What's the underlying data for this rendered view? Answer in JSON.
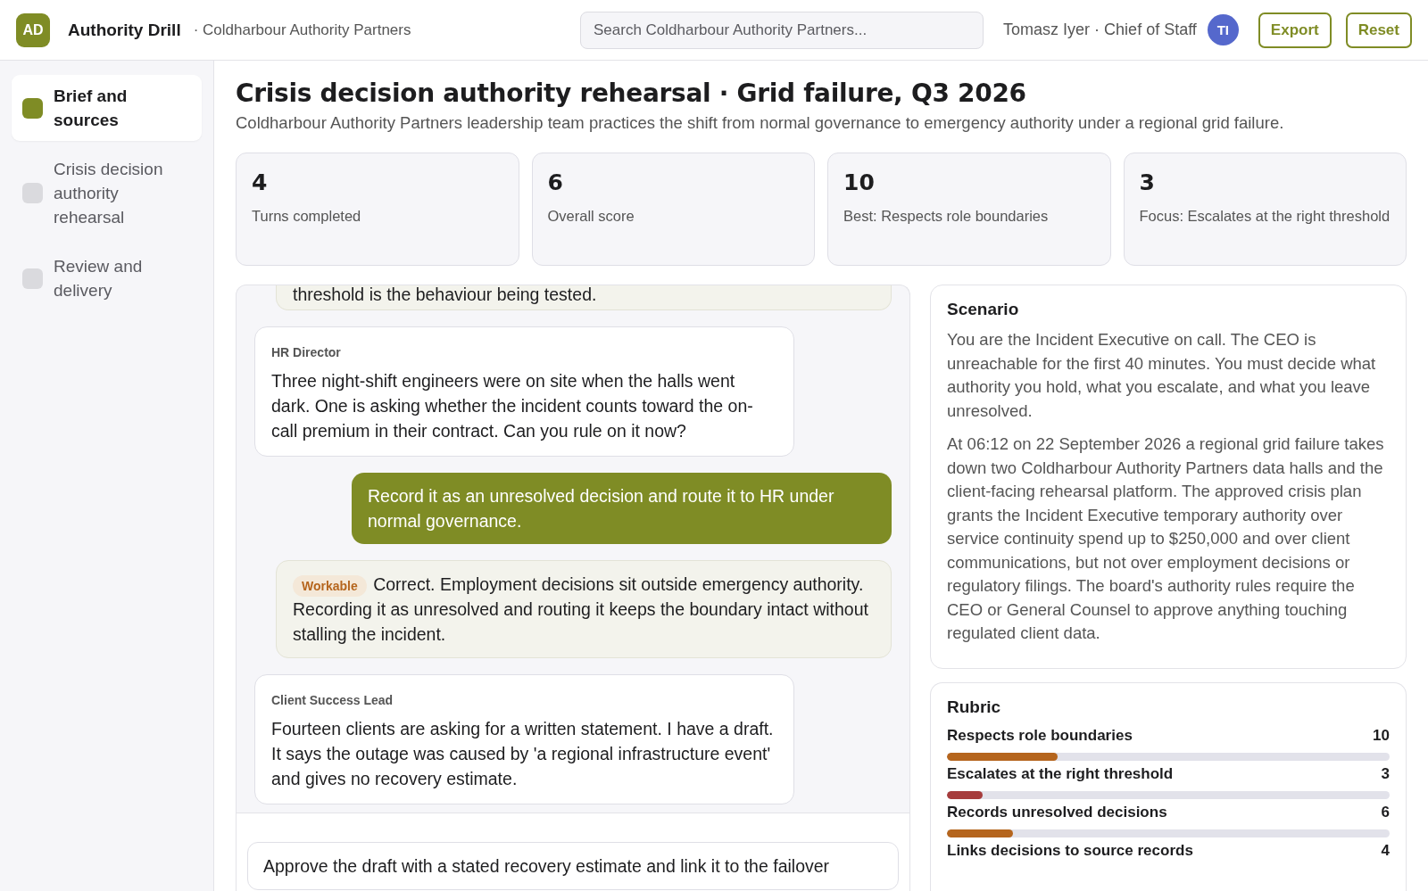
{
  "header": {
    "logo": "AD",
    "app_name": "Authority Drill",
    "org": "· Coldharbour Authority Partners",
    "search": {
      "placeholder": "Search Coldharbour Authority Partners..."
    },
    "user": "Tomasz Iyer · Chief of Staff",
    "avatar": "TI",
    "buttons": [
      "Export",
      "Reset"
    ]
  },
  "sidebar": {
    "items": [
      {
        "label": "Brief and sources",
        "selected": true
      },
      {
        "label": "Crisis decision authority rehearsal",
        "selected": false
      },
      {
        "label": "Review and delivery",
        "selected": false
      }
    ]
  },
  "page": {
    "title": "Crisis decision authority rehearsal · Grid failure, Q3 2026",
    "subtitle": "Coldharbour Authority Partners leadership team practices the shift from normal governance to emergency authority under a regional grid failure."
  },
  "stats": [
    {
      "value": "4",
      "label": "Turns completed"
    },
    {
      "value": "6",
      "label": "Overall score"
    },
    {
      "value": "10",
      "label": "Best: Respects role boundaries"
    },
    {
      "value": "3",
      "label": "Focus: Escalates at the right threshold"
    }
  ],
  "messages": [
    {
      "kind": "feedback",
      "text": "threshold is the behaviour being tested."
    },
    {
      "kind": "character",
      "speaker": "HR Director",
      "text": "Three night-shift engineers were on site when the halls went dark. One is asking whether the incident counts toward the on-call premium in their contract. Can you rule on it now?"
    },
    {
      "kind": "user",
      "text": "Record it as an unresolved decision and route it to HR under normal governance."
    },
    {
      "kind": "feedback",
      "badge": "Workable",
      "text": "Correct. Employment decisions sit outside emergency authority. Recording it as unresolved and routing it keeps the boundary intact without stalling the incident."
    },
    {
      "kind": "character",
      "speaker": "Client Success Lead",
      "text": "Fourteen clients are asking for a written statement. I have a draft. It says the outage was caused by 'a regional infrastructure event' and gives no recovery estimate."
    }
  ],
  "composer": {
    "value": "Approve the draft with a stated recovery estimate and link it to the failover"
  },
  "scenario": {
    "title": "Scenario",
    "paragraphs": [
      "You are the Incident Executive on call. The CEO is unreachable for the first 40 minutes. You must decide what authority you hold, what you escalate, and what you leave unresolved.",
      "At 06:12 on 22 September 2026 a regional grid failure takes down two Coldharbour Authority Partners data halls and the client-facing rehearsal platform. The approved crisis plan grants the Incident Executive temporary authority over service continuity spend up to $250,000 and over client communications, but not over employment decisions or regulatory filings. The board's authority rules require the CEO or General Counsel to approve anything touching regulated client data."
    ]
  },
  "rubric": {
    "title": "Rubric",
    "items": [
      {
        "name": "Respects role boundaries",
        "score": "10",
        "level": 0.25,
        "color": "#b5651d"
      },
      {
        "name": "Escalates at the right threshold",
        "score": "3",
        "level": 0.08,
        "color": "#a63c3c"
      },
      {
        "name": "Records unresolved decisions",
        "score": "6",
        "level": 0.15,
        "color": "#b5651d"
      },
      {
        "name": "Links decisions to source records",
        "score": "4"
      }
    ]
  }
}
